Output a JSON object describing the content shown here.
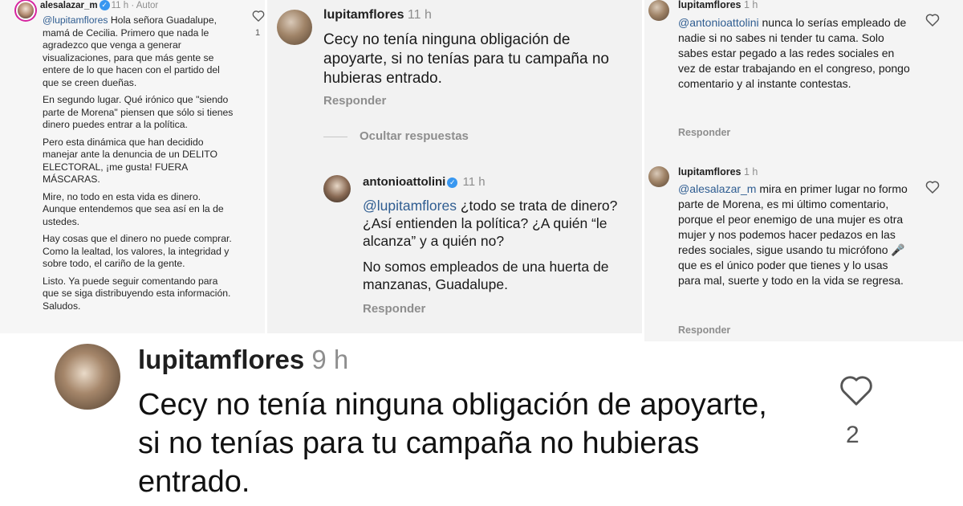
{
  "panel1": {
    "username": "alesalazar_m",
    "time": "11 h",
    "author_label": "· Autor",
    "like_count": "1",
    "mention": "@lupitamflores",
    "para1": "Hola señora Guadalupe, mamá de Cecilia. Primero que nada le agradezco que venga a generar visualizaciones, para que más gente se entere de lo que hacen con el partido del que se creen dueñas.",
    "para2": "En segundo lugar. Qué irónico que \"siendo parte de Morena\" piensen que sólo si tienes dinero puedes entrar a la política.",
    "para3": "Pero esta dinámica que han decidido manejar ante la denuncia de un DELITO ELECTORAL, ¡me gusta! FUERA MÁSCARAS.",
    "para4": "Mire, no todo en esta vida es dinero. Aunque entendemos que sea así en la de ustedes.",
    "para5": "Hay cosas que el dinero no puede comprar. Como la lealtad, los valores, la integridad y sobre todo, el cariño de la gente.",
    "para6": "Listo. Ya puede seguir comentando para que se siga distribuyendo esta información. Saludos."
  },
  "panel2": {
    "comment1": {
      "username": "lupitamflores",
      "time": "11 h",
      "text": "Cecy no tenía ninguna obligación de apoyarte, si no tenías para tu campaña no hubieras entrado.",
      "reply": "Responder"
    },
    "hide_replies": "Ocultar respuestas",
    "comment2": {
      "username": "antonioattolini",
      "time": "11 h",
      "mention": "@lupitamflores",
      "text1": "¿todo se trata de dinero? ¿Así entienden la política? ¿A quién “le alcanza” y a quién no?",
      "text2": "No somos empleados de una huerta de manzanas, Guadalupe.",
      "reply": "Responder"
    }
  },
  "panel3": {
    "comment1": {
      "username": "lupitamflores",
      "time": "1 h",
      "mention": "@antonioattolini",
      "text": "nunca lo serías empleado de nadie si no sabes ni tender tu cama. Solo sabes estar pegado a las redes sociales en vez de estar trabajando en el congreso, pongo comentario y al instante contestas.",
      "reply": "Responder"
    },
    "comment2": {
      "username": "lupitamflores",
      "time": "1 h",
      "mention": "@alesalazar_m",
      "text": "mira en primer lugar no formo parte de Morena, es mi último comentario, porque el peor enemigo de una mujer es otra mujer y nos podemos hacer pedazos en las redes sociales, sigue usando tu micrófono 🎤 que es el único poder que tienes y lo usas para mal, suerte y todo en la vida se regresa.",
      "reply": "Responder"
    }
  },
  "bottom": {
    "username": "lupitamflores",
    "time": "9 h",
    "text": "Cecy no tenía ninguna obligación de apoyarte, si no tenías para tu campaña no hubieras entrado.",
    "like_count": "2"
  },
  "icons": {
    "heart": "heart-icon",
    "verified": "verified-badge-icon",
    "microphone": "microphone-emoji"
  },
  "colors": {
    "mention": "#2f5d91",
    "verified": "#3897f0",
    "muted": "#8e8e8e"
  }
}
